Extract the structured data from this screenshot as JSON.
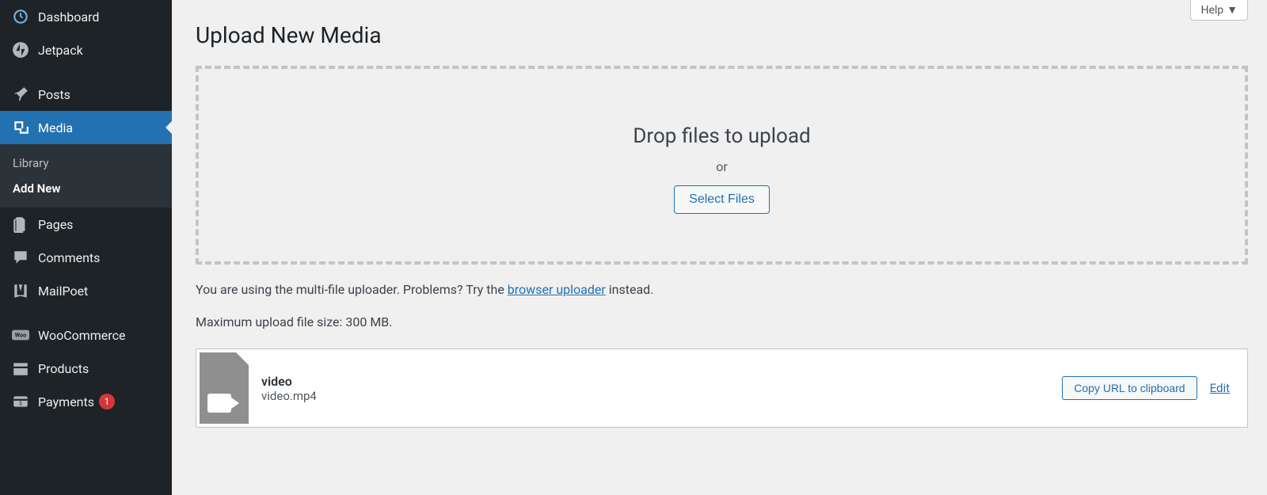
{
  "sidebar": {
    "dashboard": "Dashboard",
    "jetpack": "Jetpack",
    "posts": "Posts",
    "media": "Media",
    "media_sub": {
      "library": "Library",
      "add_new": "Add New"
    },
    "pages": "Pages",
    "comments": "Comments",
    "mailpoet": "MailPoet",
    "woocommerce": "WooCommerce",
    "products": "Products",
    "payments": "Payments",
    "payments_badge": "1"
  },
  "header": {
    "help": "Help",
    "page_title": "Upload New Media"
  },
  "drop": {
    "title": "Drop files to upload",
    "or": "or",
    "button": "Select Files"
  },
  "note": {
    "prefix": "You are using the multi-file uploader. Problems? Try the ",
    "link": "browser uploader",
    "suffix": " instead."
  },
  "max_size": "Maximum upload file size: 300 MB.",
  "file": {
    "title": "video",
    "name": "video.mp4",
    "copy": "Copy URL to clipboard",
    "edit": "Edit"
  }
}
